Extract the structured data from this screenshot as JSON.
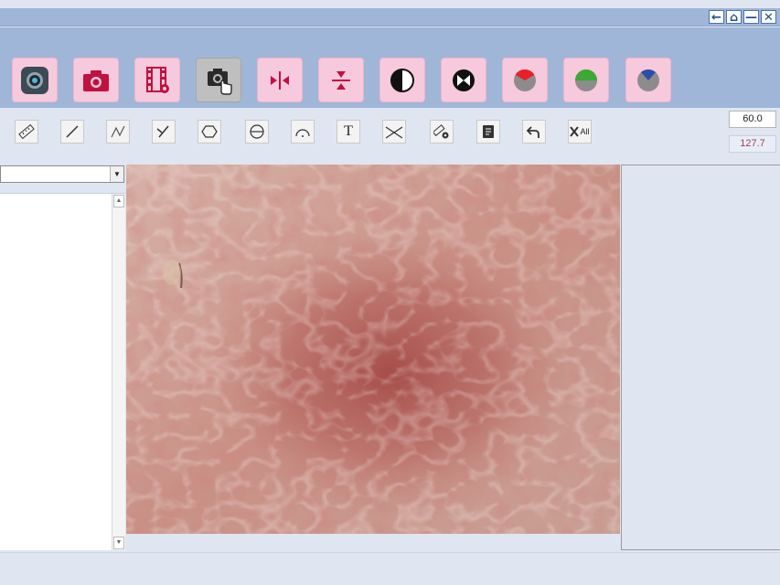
{
  "window": {
    "buttons": [
      {
        "icon": "back-arrow-icon",
        "glyph": "←"
      },
      {
        "icon": "home-icon",
        "glyph": "⌂"
      },
      {
        "icon": "minimize-icon",
        "glyph": "—"
      },
      {
        "icon": "close-icon",
        "glyph": "✕"
      }
    ]
  },
  "toolbar": {
    "buttons": [
      {
        "name": "live-view-button",
        "icon": "camera-lens-icon"
      },
      {
        "name": "snapshot-button",
        "icon": "camera-icon"
      },
      {
        "name": "record-video-button",
        "icon": "film-settings-icon"
      },
      {
        "name": "touch-capture-button",
        "icon": "camera-hand-icon",
        "active": true
      },
      {
        "name": "mirror-horizontal-button",
        "icon": "flip-horizontal-icon"
      },
      {
        "name": "mirror-vertical-button",
        "icon": "flip-vertical-icon"
      },
      {
        "name": "contrast-button",
        "icon": "half-circle-icon"
      },
      {
        "name": "invert-button",
        "icon": "invert-circle-icon"
      },
      {
        "name": "red-channel-button",
        "icon": "red-channel-icon",
        "color": "#e8202a"
      },
      {
        "name": "green-channel-button",
        "icon": "green-channel-icon",
        "color": "#3aa935"
      },
      {
        "name": "blue-channel-button",
        "icon": "blue-channel-icon",
        "color": "#2a4fa8"
      }
    ]
  },
  "draw_tools": {
    "buttons": [
      {
        "name": "ruler-tool",
        "icon": "ruler-icon"
      },
      {
        "name": "line-tool",
        "icon": "line-icon"
      },
      {
        "name": "polyline-tool",
        "icon": "polyline-icon"
      },
      {
        "name": "parallel-tool",
        "icon": "parallel-line-icon"
      },
      {
        "name": "polygon-tool",
        "icon": "hexagon-icon"
      },
      {
        "name": "circle-tool",
        "icon": "circle-diameter-icon"
      },
      {
        "name": "arc-tool",
        "icon": "arc-icon"
      },
      {
        "name": "text-tool",
        "icon": "text-icon",
        "label": "T"
      },
      {
        "name": "angle-tool",
        "icon": "angle-icon"
      },
      {
        "name": "measure-settings-tool",
        "icon": "ruler-settings-icon"
      },
      {
        "name": "report-tool",
        "icon": "document-icon"
      },
      {
        "name": "undo-tool",
        "icon": "undo-icon"
      },
      {
        "name": "clear-all-tool",
        "icon": "clear-all-icon",
        "label": "All"
      }
    ],
    "value_top": "60.0",
    "value_bottom": "127.7"
  },
  "left_panel": {
    "dropdown_value": ""
  },
  "colors": {
    "toolbar_bg": "#9fb6d8",
    "button_bg": "#f7c9dc",
    "icon_red": "#c0113f",
    "panel_bg": "#dfe6f1"
  }
}
